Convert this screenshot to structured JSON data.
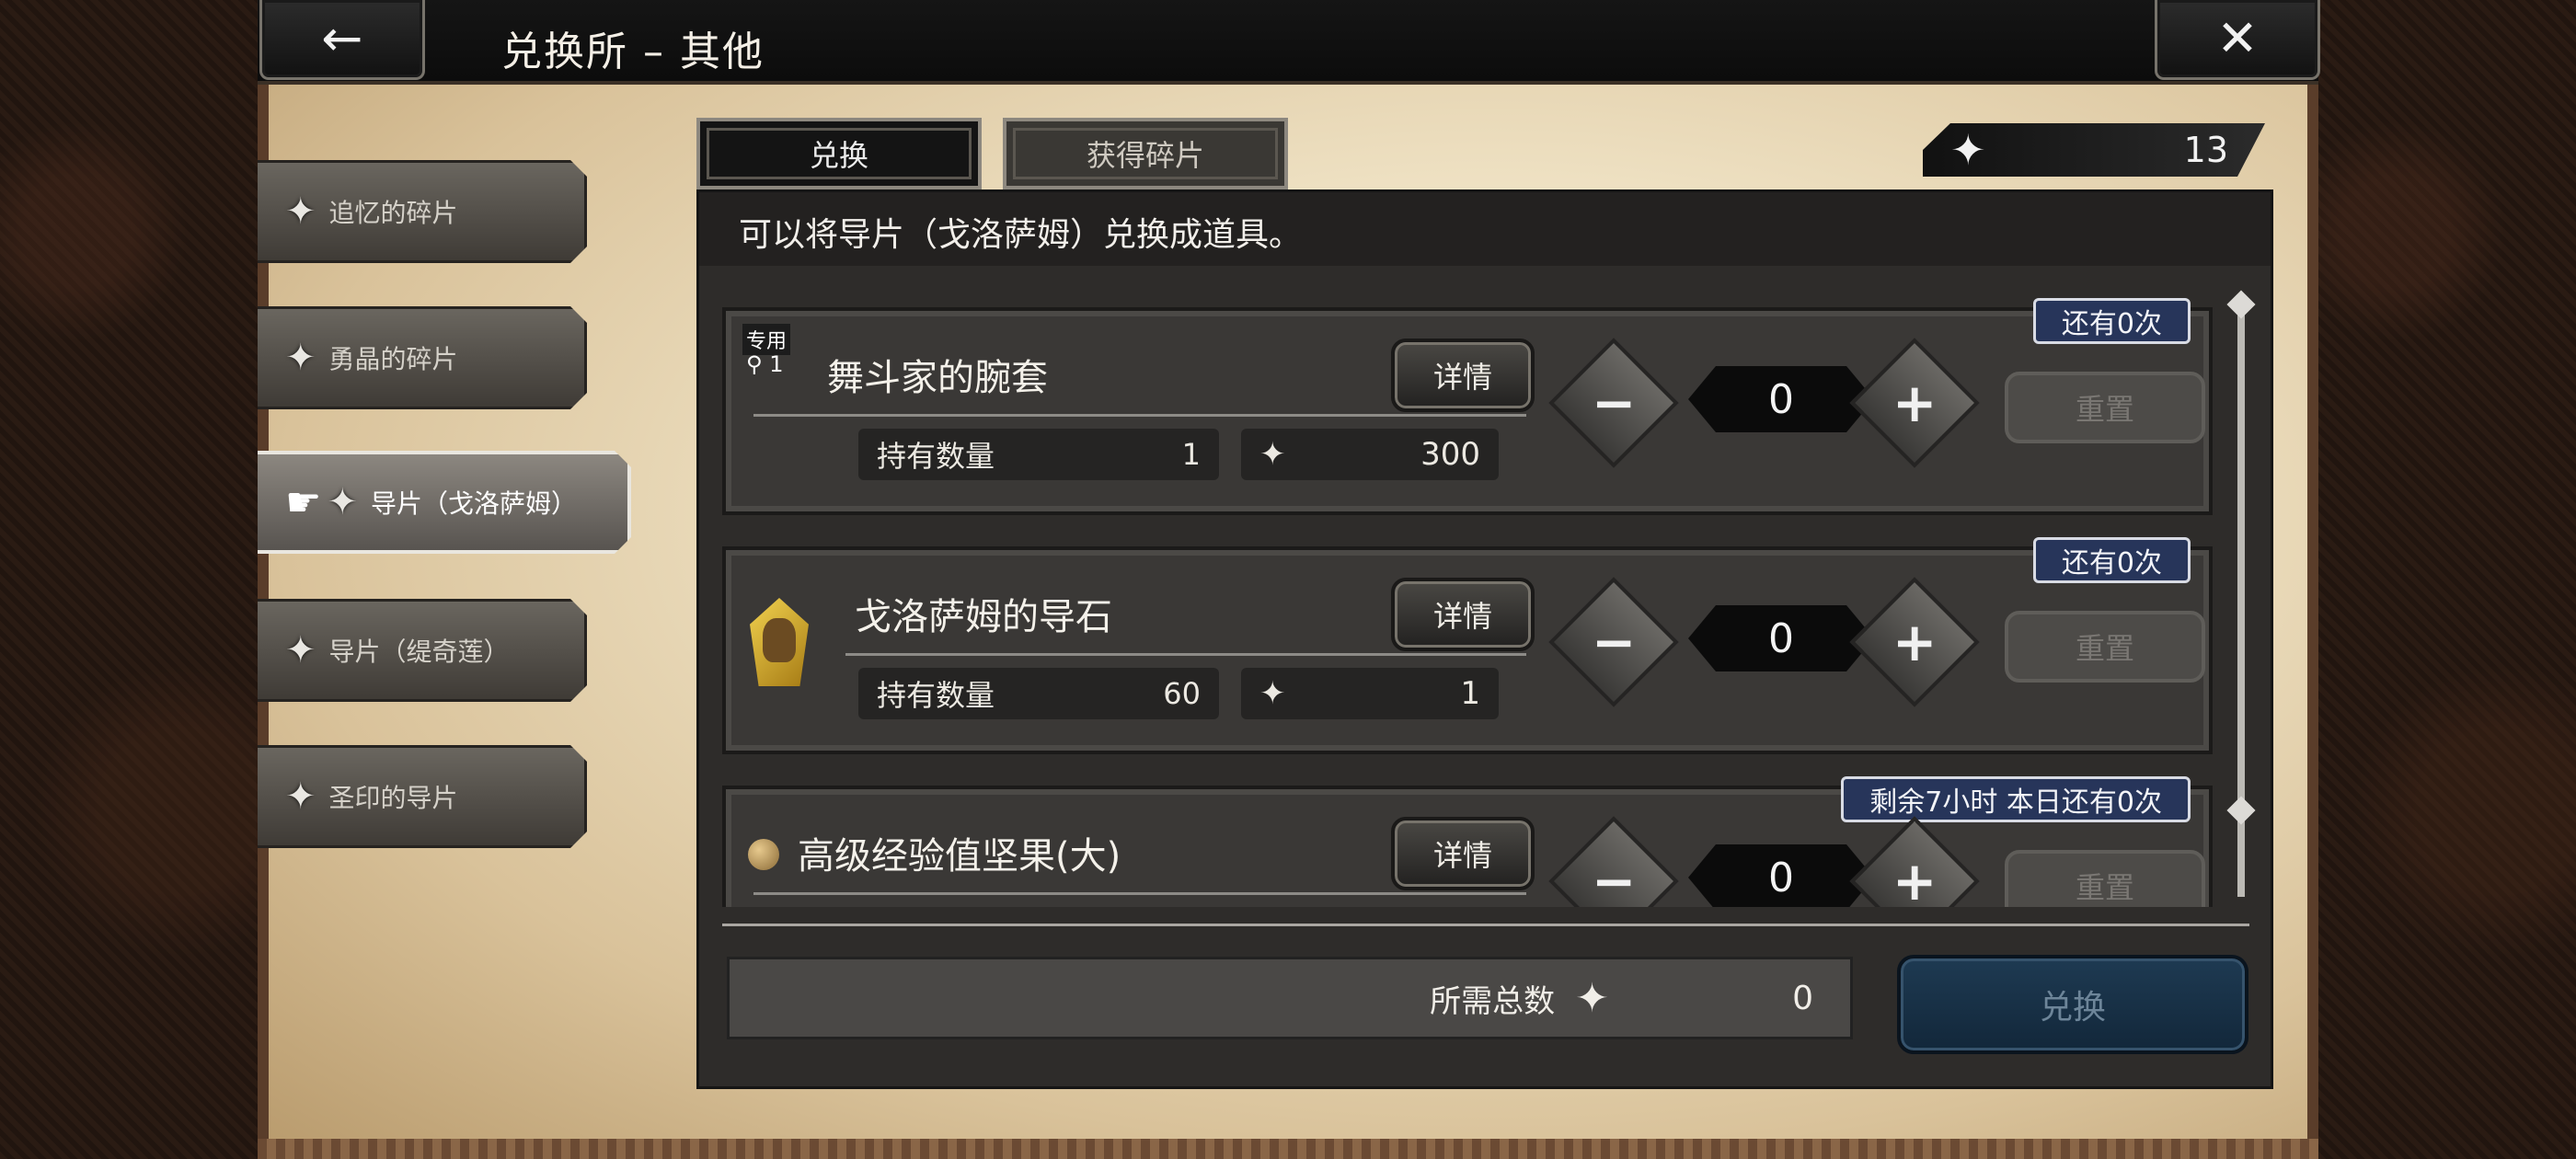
{
  "header": {
    "title": "兑换所 – 其他",
    "back_icon": "←",
    "close_icon": "✕"
  },
  "sidebar": {
    "items": [
      {
        "label": "追忆的碎片",
        "active": false
      },
      {
        "label": "勇晶的碎片",
        "active": false
      },
      {
        "label": "导片（戈洛萨姆）",
        "active": true
      },
      {
        "label": "导片（缇奇莲）",
        "active": false
      },
      {
        "label": "圣印的导片",
        "active": false
      }
    ]
  },
  "tabs": [
    {
      "label": "兑换",
      "active": true
    },
    {
      "label": "获得碎片",
      "active": false
    }
  ],
  "currency": {
    "amount": "13",
    "icon": "diamond-star-icon"
  },
  "description": "可以将导片（戈洛萨姆）兑换成道具。",
  "items": [
    {
      "badge": "还有0次",
      "exclusive_label": "专用",
      "level": "1",
      "name": "舞斗家的腕套",
      "detail_label": "详情",
      "owned_label": "持有数量",
      "owned_value": "1",
      "cost": "300",
      "quantity": "0",
      "reset_label": "重置"
    },
    {
      "badge": "还有0次",
      "name": "戈洛萨姆的导石",
      "detail_label": "详情",
      "owned_label": "持有数量",
      "owned_value": "60",
      "cost": "1",
      "quantity": "0",
      "reset_label": "重置"
    },
    {
      "badge": "剩余7小时  本日还有0次",
      "name": "高级经验值坚果(大)",
      "detail_label": "详情",
      "quantity": "0",
      "reset_label": "重置"
    }
  ],
  "footer": {
    "total_label": "所需总数",
    "total_value": "0",
    "exchange_label": "兑换"
  },
  "colors": {
    "badge_bg": "#27355a",
    "exchange_button": "#1e3a52"
  }
}
